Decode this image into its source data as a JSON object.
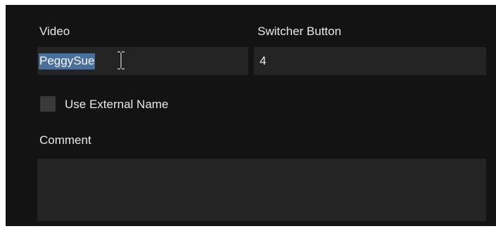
{
  "video": {
    "label": "Video",
    "value": "PeggySue",
    "text_selected": true
  },
  "switcher_button": {
    "label": "Switcher Button",
    "value": "4"
  },
  "use_external_name": {
    "label": "Use External Name",
    "checked": false
  },
  "comment": {
    "label": "Comment",
    "value": ""
  },
  "cursor": {
    "icon": "text-ibeam-cursor-icon"
  },
  "colors": {
    "panel_bg": "#131313",
    "field_bg": "#242424",
    "selection_bg": "#4a6f98",
    "text": "#e8e8e8"
  }
}
